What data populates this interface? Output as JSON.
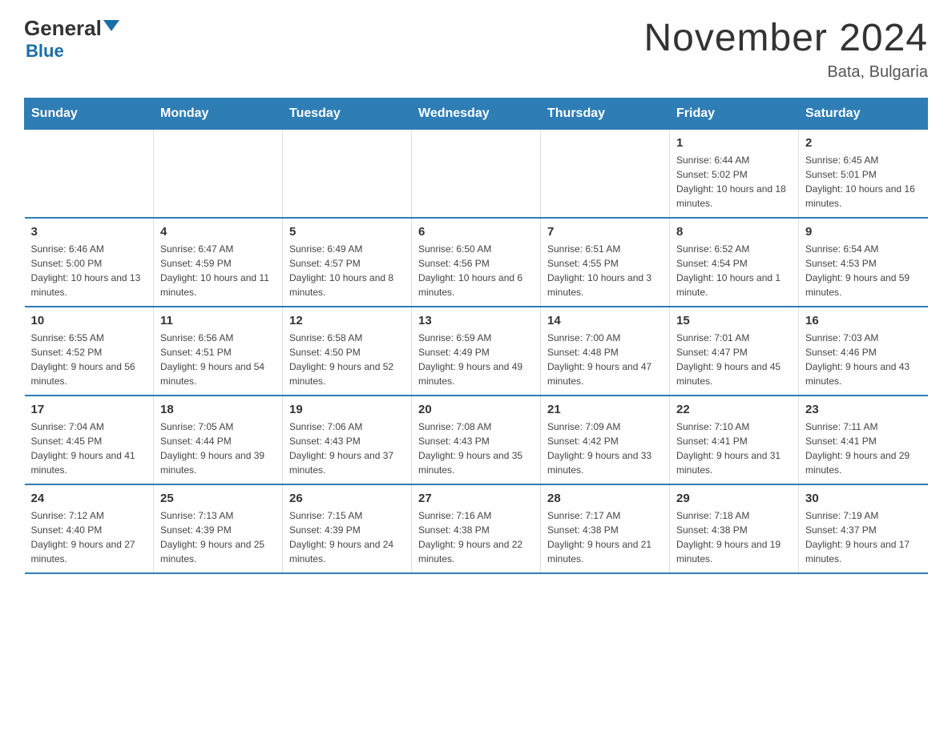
{
  "header": {
    "logo_general": "General",
    "logo_blue": "Blue",
    "month_title": "November 2024",
    "location": "Bata, Bulgaria"
  },
  "calendar": {
    "days_of_week": [
      "Sunday",
      "Monday",
      "Tuesday",
      "Wednesday",
      "Thursday",
      "Friday",
      "Saturday"
    ],
    "weeks": [
      [
        {
          "day": "",
          "info": ""
        },
        {
          "day": "",
          "info": ""
        },
        {
          "day": "",
          "info": ""
        },
        {
          "day": "",
          "info": ""
        },
        {
          "day": "",
          "info": ""
        },
        {
          "day": "1",
          "info": "Sunrise: 6:44 AM\nSunset: 5:02 PM\nDaylight: 10 hours and 18 minutes."
        },
        {
          "day": "2",
          "info": "Sunrise: 6:45 AM\nSunset: 5:01 PM\nDaylight: 10 hours and 16 minutes."
        }
      ],
      [
        {
          "day": "3",
          "info": "Sunrise: 6:46 AM\nSunset: 5:00 PM\nDaylight: 10 hours and 13 minutes."
        },
        {
          "day": "4",
          "info": "Sunrise: 6:47 AM\nSunset: 4:59 PM\nDaylight: 10 hours and 11 minutes."
        },
        {
          "day": "5",
          "info": "Sunrise: 6:49 AM\nSunset: 4:57 PM\nDaylight: 10 hours and 8 minutes."
        },
        {
          "day": "6",
          "info": "Sunrise: 6:50 AM\nSunset: 4:56 PM\nDaylight: 10 hours and 6 minutes."
        },
        {
          "day": "7",
          "info": "Sunrise: 6:51 AM\nSunset: 4:55 PM\nDaylight: 10 hours and 3 minutes."
        },
        {
          "day": "8",
          "info": "Sunrise: 6:52 AM\nSunset: 4:54 PM\nDaylight: 10 hours and 1 minute."
        },
        {
          "day": "9",
          "info": "Sunrise: 6:54 AM\nSunset: 4:53 PM\nDaylight: 9 hours and 59 minutes."
        }
      ],
      [
        {
          "day": "10",
          "info": "Sunrise: 6:55 AM\nSunset: 4:52 PM\nDaylight: 9 hours and 56 minutes."
        },
        {
          "day": "11",
          "info": "Sunrise: 6:56 AM\nSunset: 4:51 PM\nDaylight: 9 hours and 54 minutes."
        },
        {
          "day": "12",
          "info": "Sunrise: 6:58 AM\nSunset: 4:50 PM\nDaylight: 9 hours and 52 minutes."
        },
        {
          "day": "13",
          "info": "Sunrise: 6:59 AM\nSunset: 4:49 PM\nDaylight: 9 hours and 49 minutes."
        },
        {
          "day": "14",
          "info": "Sunrise: 7:00 AM\nSunset: 4:48 PM\nDaylight: 9 hours and 47 minutes."
        },
        {
          "day": "15",
          "info": "Sunrise: 7:01 AM\nSunset: 4:47 PM\nDaylight: 9 hours and 45 minutes."
        },
        {
          "day": "16",
          "info": "Sunrise: 7:03 AM\nSunset: 4:46 PM\nDaylight: 9 hours and 43 minutes."
        }
      ],
      [
        {
          "day": "17",
          "info": "Sunrise: 7:04 AM\nSunset: 4:45 PM\nDaylight: 9 hours and 41 minutes."
        },
        {
          "day": "18",
          "info": "Sunrise: 7:05 AM\nSunset: 4:44 PM\nDaylight: 9 hours and 39 minutes."
        },
        {
          "day": "19",
          "info": "Sunrise: 7:06 AM\nSunset: 4:43 PM\nDaylight: 9 hours and 37 minutes."
        },
        {
          "day": "20",
          "info": "Sunrise: 7:08 AM\nSunset: 4:43 PM\nDaylight: 9 hours and 35 minutes."
        },
        {
          "day": "21",
          "info": "Sunrise: 7:09 AM\nSunset: 4:42 PM\nDaylight: 9 hours and 33 minutes."
        },
        {
          "day": "22",
          "info": "Sunrise: 7:10 AM\nSunset: 4:41 PM\nDaylight: 9 hours and 31 minutes."
        },
        {
          "day": "23",
          "info": "Sunrise: 7:11 AM\nSunset: 4:41 PM\nDaylight: 9 hours and 29 minutes."
        }
      ],
      [
        {
          "day": "24",
          "info": "Sunrise: 7:12 AM\nSunset: 4:40 PM\nDaylight: 9 hours and 27 minutes."
        },
        {
          "day": "25",
          "info": "Sunrise: 7:13 AM\nSunset: 4:39 PM\nDaylight: 9 hours and 25 minutes."
        },
        {
          "day": "26",
          "info": "Sunrise: 7:15 AM\nSunset: 4:39 PM\nDaylight: 9 hours and 24 minutes."
        },
        {
          "day": "27",
          "info": "Sunrise: 7:16 AM\nSunset: 4:38 PM\nDaylight: 9 hours and 22 minutes."
        },
        {
          "day": "28",
          "info": "Sunrise: 7:17 AM\nSunset: 4:38 PM\nDaylight: 9 hours and 21 minutes."
        },
        {
          "day": "29",
          "info": "Sunrise: 7:18 AM\nSunset: 4:38 PM\nDaylight: 9 hours and 19 minutes."
        },
        {
          "day": "30",
          "info": "Sunrise: 7:19 AM\nSunset: 4:37 PM\nDaylight: 9 hours and 17 minutes."
        }
      ]
    ]
  }
}
